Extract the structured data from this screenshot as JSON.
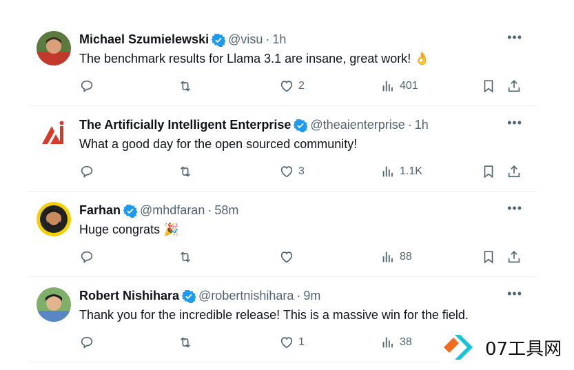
{
  "tweets": [
    {
      "name": "Michael Szumielewski",
      "handle": "@visu",
      "time": "1h",
      "text": "The benchmark results for Llama 3.1 are insane, great work! 👌",
      "likes": "2",
      "views": "401",
      "avatar": "person-photo"
    },
    {
      "name": "The Artificially Intelligent Enterprise",
      "handle": "@theaienterprise",
      "time": "1h",
      "text": "What a good day for the open sourced community!",
      "likes": "3",
      "views": "1.1K",
      "avatar": "red-ai-logo"
    },
    {
      "name": "Farhan",
      "handle": "@mhdfaran",
      "time": "58m",
      "text": "Huge congrats 🎉",
      "likes": "",
      "views": "88",
      "avatar": "person-photo"
    },
    {
      "name": "Robert Nishihara",
      "handle": "@robertnishihara",
      "time": "9m",
      "text": "Thank you for the incredible release! This is a massive win for the field.",
      "likes": "1",
      "views": "38",
      "avatar": "person-photo"
    }
  ],
  "separator": "·",
  "more_label": "•••",
  "watermark": {
    "text": "07工具网"
  },
  "colors": {
    "verified": "#1d9bf0",
    "muted": "#536471",
    "logo_red": "#d83a2a",
    "wm_orange": "#f26b21",
    "wm_cyan": "#17c3d6"
  }
}
